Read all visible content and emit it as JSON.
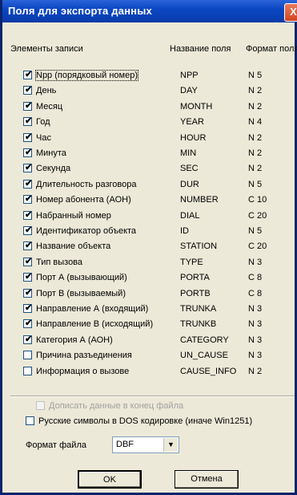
{
  "window": {
    "title": "Поля для экспорта данных",
    "close_symbol": "X"
  },
  "headers": {
    "elements": "Элементы записи",
    "field_name": "Название поля",
    "field_format": "Формат поля"
  },
  "rows": [
    {
      "label": "Npp (порядковый номер)",
      "name": "NPP",
      "format": "N 5",
      "checked": true
    },
    {
      "label": "День",
      "name": "DAY",
      "format": "N 2",
      "checked": true
    },
    {
      "label": "Месяц",
      "name": "MONTH",
      "format": "N 2",
      "checked": true
    },
    {
      "label": "Год",
      "name": "YEAR",
      "format": "N 4",
      "checked": true
    },
    {
      "label": "Час",
      "name": "HOUR",
      "format": "N 2",
      "checked": true
    },
    {
      "label": "Минута",
      "name": "MIN",
      "format": "N 2",
      "checked": true
    },
    {
      "label": "Секунда",
      "name": "SEC",
      "format": "N 2",
      "checked": true
    },
    {
      "label": "Длительность разговора",
      "name": "DUR",
      "format": "N 5",
      "checked": true
    },
    {
      "label": "Номер абонента (АОН)",
      "name": "NUMBER",
      "format": "C 10",
      "checked": true
    },
    {
      "label": "Набранный номер",
      "name": "DIAL",
      "format": "C 20",
      "checked": true
    },
    {
      "label": "Идентификатор объекта",
      "name": "ID",
      "format": "N 5",
      "checked": true
    },
    {
      "label": "Название объекта",
      "name": "STATION",
      "format": "C 20",
      "checked": true
    },
    {
      "label": "Тип вызова",
      "name": "TYPE",
      "format": "N 3",
      "checked": true
    },
    {
      "label": "Порт А (вызывающий)",
      "name": "PORTA",
      "format": "C 8",
      "checked": true
    },
    {
      "label": "Порт В (вызываемый)",
      "name": "PORTB",
      "format": "C 8",
      "checked": true
    },
    {
      "label": "Направление А (входящий)",
      "name": "TRUNKA",
      "format": "N 3",
      "checked": true
    },
    {
      "label": "Направление В (исходящий)",
      "name": "TRUNKB",
      "format": "N 3",
      "checked": true
    },
    {
      "label": "Категория А (АОН)",
      "name": "CATEGORY",
      "format": "N 3",
      "checked": true
    },
    {
      "label": "Причина разъединения",
      "name": "UN_CAUSE",
      "format": "N 3",
      "checked": false
    },
    {
      "label": "Информация о вызове",
      "name": "CAUSE_INFO",
      "format": "N 2",
      "checked": false
    }
  ],
  "options": {
    "append_label": "Дописать данные в конец файла",
    "append_checked": false,
    "append_enabled": false,
    "dos_label": "Русские символы в DOS кодировке (иначе Win1251)",
    "dos_checked": false
  },
  "file_format": {
    "label": "Формат файла",
    "value": "DBF"
  },
  "buttons": {
    "ok": "OK",
    "cancel": "Отмена"
  },
  "colors": {
    "titlebar": "#0a3fb3",
    "dialog_bg": "#ece9d8",
    "close": "#d2451f"
  }
}
